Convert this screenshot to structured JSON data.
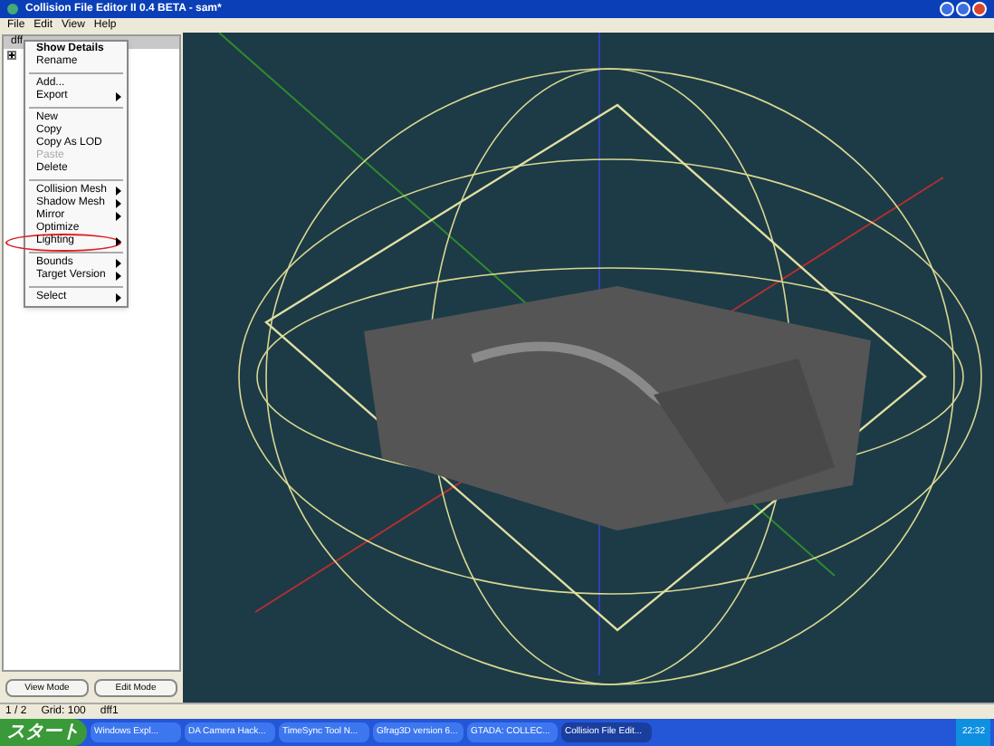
{
  "window": {
    "title": "Collision File Editor II 0.4 BETA - sam*"
  },
  "menu_bar": [
    {
      "label": "File"
    },
    {
      "label": "Edit"
    },
    {
      "label": "View"
    },
    {
      "label": "Help"
    }
  ],
  "tree": {
    "header": "dff",
    "items": [
      {
        "expanded": false
      }
    ]
  },
  "context_menu": [
    {
      "kind": "item",
      "label": "Show Details",
      "default": true,
      "submenu": false,
      "disabled": false,
      "annotated": false
    },
    {
      "kind": "item",
      "label": "Rename",
      "default": false,
      "submenu": false,
      "disabled": false,
      "annotated": false
    },
    {
      "kind": "separator"
    },
    {
      "kind": "item",
      "label": "Add...",
      "default": false,
      "submenu": false,
      "disabled": false,
      "annotated": false
    },
    {
      "kind": "item",
      "label": "Export",
      "default": false,
      "submenu": true,
      "disabled": false,
      "annotated": false
    },
    {
      "kind": "separator"
    },
    {
      "kind": "item",
      "label": "New",
      "default": false,
      "submenu": false,
      "disabled": false,
      "annotated": false
    },
    {
      "kind": "item",
      "label": "Copy",
      "default": false,
      "submenu": false,
      "disabled": false,
      "annotated": false
    },
    {
      "kind": "item",
      "label": "Copy As LOD",
      "default": false,
      "submenu": false,
      "disabled": false,
      "annotated": false
    },
    {
      "kind": "item",
      "label": "Paste",
      "default": false,
      "submenu": false,
      "disabled": true,
      "annotated": false
    },
    {
      "kind": "item",
      "label": "Delete",
      "default": false,
      "submenu": false,
      "disabled": false,
      "annotated": false
    },
    {
      "kind": "separator"
    },
    {
      "kind": "item",
      "label": "Collision Mesh",
      "default": false,
      "submenu": true,
      "disabled": false,
      "annotated": false
    },
    {
      "kind": "item",
      "label": "Shadow Mesh",
      "default": false,
      "submenu": true,
      "disabled": false,
      "annotated": false
    },
    {
      "kind": "item",
      "label": "Mirror",
      "default": false,
      "submenu": true,
      "disabled": false,
      "annotated": false
    },
    {
      "kind": "item",
      "label": "Optimize",
      "default": false,
      "submenu": false,
      "disabled": false,
      "annotated": false
    },
    {
      "kind": "item",
      "label": "Lighting",
      "default": false,
      "submenu": true,
      "disabled": false,
      "annotated": true
    },
    {
      "kind": "separator"
    },
    {
      "kind": "item",
      "label": "Bounds",
      "default": false,
      "submenu": true,
      "disabled": false,
      "annotated": false
    },
    {
      "kind": "item",
      "label": "Target Version",
      "default": false,
      "submenu": true,
      "disabled": false,
      "annotated": false
    },
    {
      "kind": "separator"
    },
    {
      "kind": "item",
      "label": "Select",
      "default": false,
      "submenu": true,
      "disabled": false,
      "annotated": false
    }
  ],
  "buttons": [
    {
      "label": "View Mode"
    },
    {
      "label": "Edit Mode"
    }
  ],
  "status_bar": [
    {
      "text": "1 / 2"
    },
    {
      "text": "Grid: 100"
    },
    {
      "text": "dff1"
    }
  ],
  "taskbar": {
    "start": "スタート",
    "tasks": [
      {
        "label": "Windows Expl...",
        "selected": false
      },
      {
        "label": "DA Camera Hack...",
        "selected": false
      },
      {
        "label": "TimeSync Tool N...",
        "selected": false
      },
      {
        "label": "Gfrag3D version 6...",
        "selected": false
      },
      {
        "label": "GTADA: COLLEC...",
        "selected": false
      },
      {
        "label": "Collision File Edit...",
        "selected": true
      }
    ],
    "clock": "22:32"
  }
}
